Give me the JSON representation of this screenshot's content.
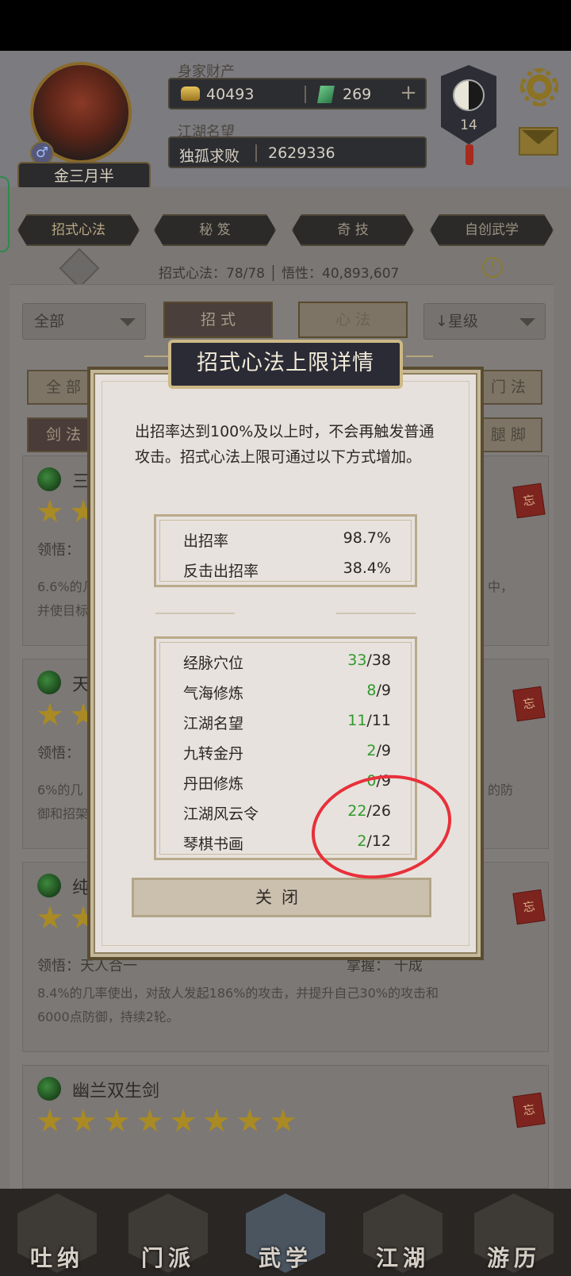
{
  "header": {
    "wealth_caption": "身家财产",
    "gold_value": "40493",
    "jade_value": "269",
    "plus_label": "+",
    "fame_caption": "江湖名望",
    "fame_title": "独孤求败",
    "fame_value": "2629336",
    "player_name": "金三月半",
    "gender_symbol": "♂",
    "level": "14",
    "icons": [
      "gear-icon",
      "mail-icon",
      "taiji-icon",
      "gold-ingot-icon",
      "jade-icon"
    ]
  },
  "tabs": [
    "招式心法",
    "秘 笈",
    "奇 技",
    "自创武学"
  ],
  "stats_line": "招式心法：78/78 │ 悟性：40,893,607",
  "info_symbol": "!",
  "filters": {
    "category_selected": "全部",
    "sort_selected": "↓星级",
    "segment": [
      "招 式",
      "心 法"
    ],
    "chips": [
      "全 部",
      "门 法",
      "剑 法",
      "腿 脚"
    ]
  },
  "cards": [
    {
      "title": "三",
      "stars": 2,
      "insight_label": "领悟：",
      "desc_left": "6.6%的几",
      "desc_left2": "并使目标",
      "desc_right": "中，",
      "seal": "忘"
    },
    {
      "title": "天",
      "stars": 2,
      "insight_label": "领悟：",
      "desc_left": "6%的几",
      "desc_left2": "御和招架",
      "desc_right": "的防",
      "seal": "忘"
    },
    {
      "title": "纯",
      "stars": 2,
      "insight_label": "领悟：天人合一",
      "mastery_label": "掌握：  十成",
      "desc": "8.4%的几率使出，对敌人发起186%的攻击，并提升自己30%的攻击和",
      "desc2": "6000点防御，持续2轮。",
      "seal": "忘"
    },
    {
      "title": "幽兰双生剑",
      "stars": 8,
      "seal": "忘"
    }
  ],
  "modal": {
    "title": "招式心法上限详情",
    "description": "出招率达到100%及以上时，不会再触发普通攻击。招式心法上限可通过以下方式增加。",
    "rates": [
      {
        "label": "出招率",
        "value": "98.7%"
      },
      {
        "label": "反击出招率",
        "value": "38.4%"
      }
    ],
    "sources": [
      {
        "label": "经脉穴位",
        "current": "33",
        "max": "/38"
      },
      {
        "label": "气海修炼",
        "current": "8",
        "max": "/9"
      },
      {
        "label": "江湖名望",
        "current": "11",
        "max": "/11"
      },
      {
        "label": "九转金丹",
        "current": "2",
        "max": "/9"
      },
      {
        "label": "丹田修炼",
        "current": "0",
        "max": "/9"
      },
      {
        "label": "江湖风云令",
        "current": "22",
        "max": "/26"
      },
      {
        "label": "琴棋书画",
        "current": "2",
        "max": "/12"
      }
    ],
    "close_label": "关闭"
  },
  "nav": [
    {
      "label": "吐纳",
      "icon": "meditation-icon"
    },
    {
      "label": "门派",
      "icon": "sect-icon"
    },
    {
      "label": "武学",
      "icon": "martial-book-icon"
    },
    {
      "label": "江湖",
      "icon": "straw-hat-icon"
    },
    {
      "label": "游历",
      "icon": "horse-icon"
    }
  ],
  "colors": {
    "accent_green": "#2f9a2a",
    "annotation_red": "#e8303a",
    "gold": "#a98a24"
  }
}
